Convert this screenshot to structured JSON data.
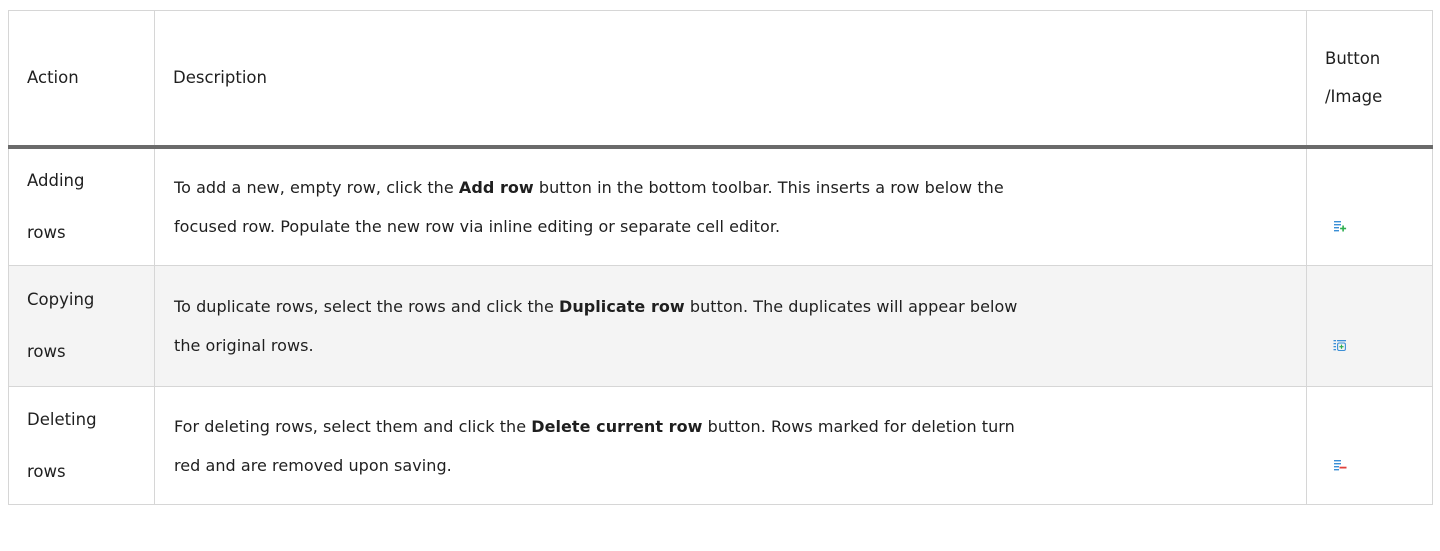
{
  "table": {
    "headers": {
      "action": "Action",
      "description": "Description",
      "button_line1": "Button",
      "button_line2": "/Image"
    },
    "rows": [
      {
        "action_line1": "Adding",
        "action_line2": "rows",
        "desc_before": "To add a new, empty row, click the ",
        "desc_bold": "Add row",
        "desc_after_line1": " button in the bottom toolbar. This inserts a row below the",
        "desc_line2": "focused row. Populate the new row via inline editing or separate cell editor.",
        "icon": "add-row-icon"
      },
      {
        "action_line1": "Copying",
        "action_line2": "rows",
        "desc_before": "To duplicate rows, select the rows and click the ",
        "desc_bold": "Duplicate row",
        "desc_after_line1": " button. The duplicates will appear below",
        "desc_line2": "the original rows.",
        "icon": "duplicate-row-icon"
      },
      {
        "action_line1": "Deleting",
        "action_line2": "rows",
        "desc_before": "For deleting rows, select them and click the ",
        "desc_bold": "Delete current row",
        "desc_after_line1": " button. Rows marked for deletion turn",
        "desc_line2": "red and are removed upon saving.",
        "icon": "delete-row-icon"
      }
    ]
  },
  "colors": {
    "header_rule": "#6b6b6b",
    "cell_border": "#d6d6d6",
    "alt_row": "#f4f4f4",
    "icon_blue": "#3b8fd6",
    "icon_green": "#2eae4f",
    "icon_red": "#e0413c"
  }
}
